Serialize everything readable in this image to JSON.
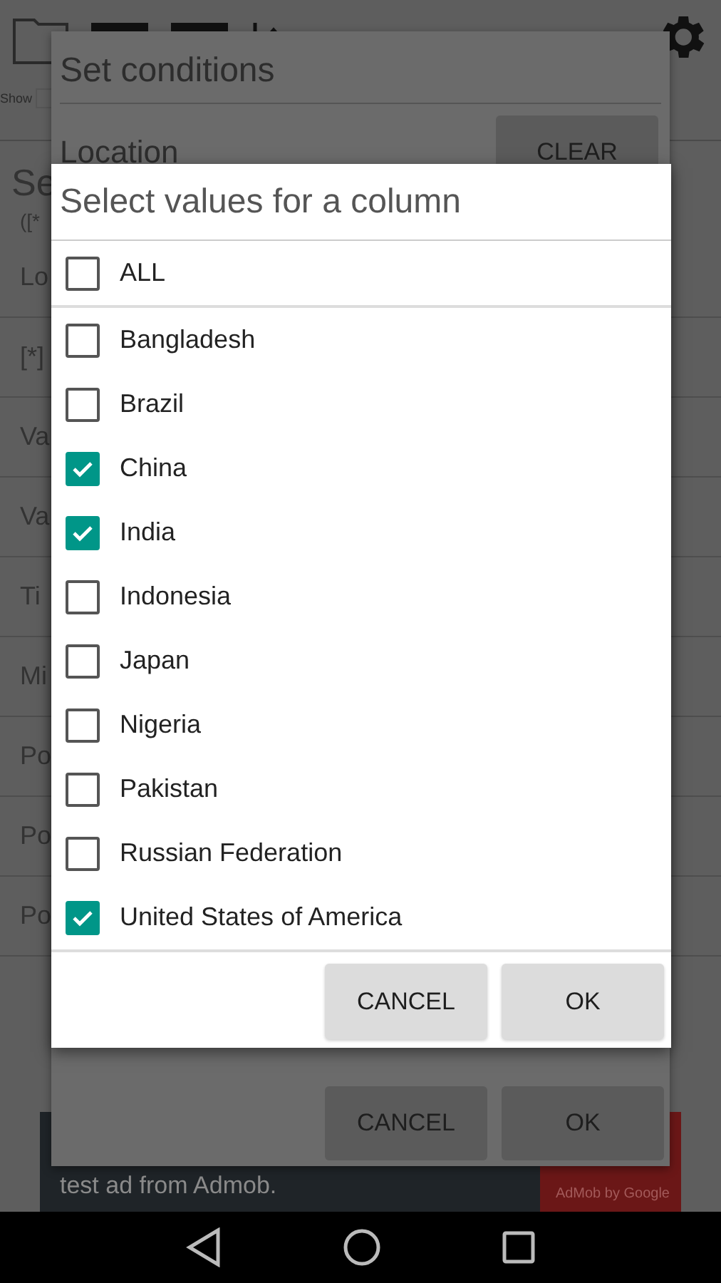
{
  "toolbar": {
    "show_label": "Show"
  },
  "background_list": {
    "title": "Se",
    "subtitle": "([*",
    "rows": [
      "Lo",
      "[*]",
      "Va",
      "Va",
      "Ti",
      "Mi",
      "Po",
      "Po",
      "Po"
    ]
  },
  "ad": {
    "text": "test ad from Admob.",
    "badge": "AdMob by Google"
  },
  "conditions_dialog": {
    "title": "Set conditions",
    "field_label": "Location",
    "clear_button": "CLEAR",
    "buttons": [
      "CANCEL",
      "OK"
    ]
  },
  "values_dialog": {
    "title": "Select values for a column",
    "all": {
      "label": "ALL",
      "checked": false
    },
    "items": [
      {
        "label": "Bangladesh",
        "checked": false
      },
      {
        "label": "Brazil",
        "checked": false
      },
      {
        "label": "China",
        "checked": true
      },
      {
        "label": "India",
        "checked": true
      },
      {
        "label": "Indonesia",
        "checked": false
      },
      {
        "label": "Japan",
        "checked": false
      },
      {
        "label": "Nigeria",
        "checked": false
      },
      {
        "label": "Pakistan",
        "checked": false
      },
      {
        "label": "Russian Federation",
        "checked": false
      },
      {
        "label": "United States of America",
        "checked": true
      }
    ],
    "buttons": [
      "CANCEL",
      "OK"
    ]
  }
}
